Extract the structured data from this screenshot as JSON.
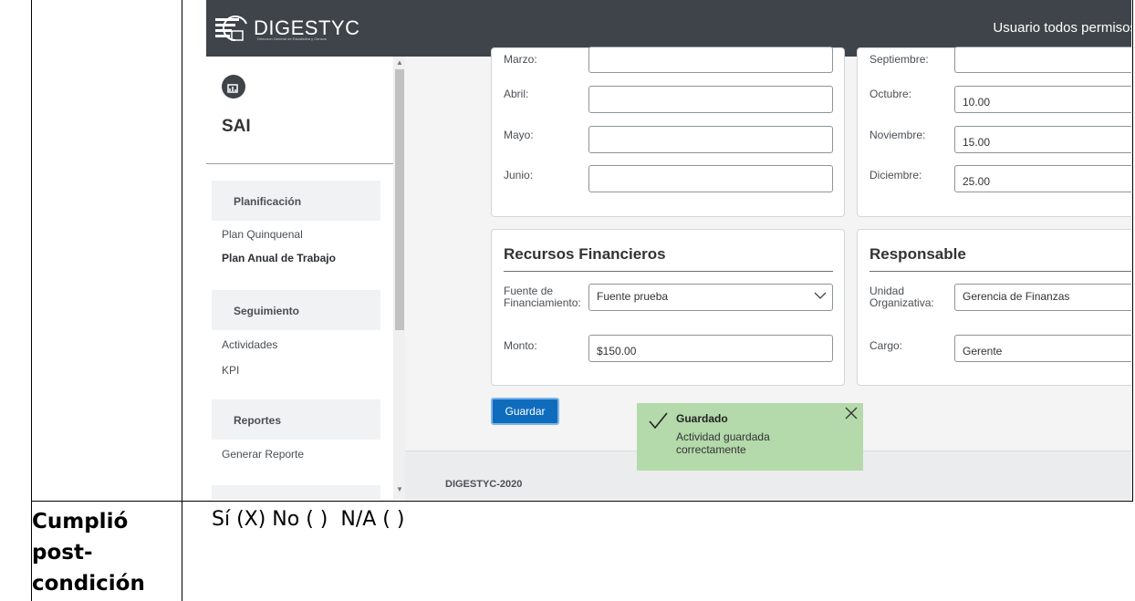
{
  "app": {
    "brand": "DIGESTYC",
    "brand_sub": "Direccion General de Estadistica y Censos",
    "user": "Usuario todos permisos"
  },
  "sidebar": {
    "title": "SAI",
    "sections": [
      {
        "heading": "Planificación",
        "items": [
          "Plan Quinquenal",
          "Plan Anual de Trabajo"
        ]
      },
      {
        "heading": "Seguimiento",
        "items": [
          "Actividades",
          "KPI"
        ]
      },
      {
        "heading": "Reportes",
        "items": [
          "Generar Reporte"
        ]
      }
    ]
  },
  "months_left": [
    {
      "label": "Marzo:",
      "value": ""
    },
    {
      "label": "Abril:",
      "value": ""
    },
    {
      "label": "Mayo:",
      "value": ""
    },
    {
      "label": "Junio:",
      "value": ""
    }
  ],
  "months_right": [
    {
      "label": "Septiembre:",
      "value": ""
    },
    {
      "label": "Octubre:",
      "value": "10.00"
    },
    {
      "label": "Noviembre:",
      "value": "15.00"
    },
    {
      "label": "Diciembre:",
      "value": "25.00"
    }
  ],
  "recursos": {
    "title": "Recursos Financieros",
    "fuente_label": "Fuente de Financiamiento:",
    "fuente_value": "Fuente prueba",
    "monto_label": "Monto:",
    "monto_value": "$150.00"
  },
  "responsable": {
    "title": "Responsable",
    "unidad_label": "Unidad Organizativa:",
    "unidad_value": "Gerencia de Finanzas",
    "cargo_label": "Cargo:",
    "cargo_value": "Gerente"
  },
  "actions": {
    "save_label": "Guardar"
  },
  "toast": {
    "title": "Guardado",
    "message": "Actividad guardada correctamente"
  },
  "footer": {
    "text": "DIGESTYC-2020"
  },
  "doc_row": {
    "label": "Cumplió post-condición",
    "value": "Sí (X) No ( )  N/A ( )"
  }
}
